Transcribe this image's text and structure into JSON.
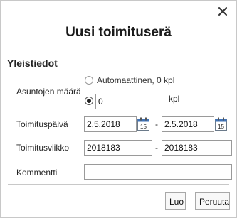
{
  "dialog": {
    "title": "Uusi toimituserä",
    "close_label": "×"
  },
  "section": {
    "heading": "Yleistiedot"
  },
  "quantity": {
    "label": "Asuntojen määrä",
    "auto_option": "Automaattinen, 0 kpl",
    "manual_value": "0",
    "unit": "kpl"
  },
  "delivery_date": {
    "label": "Toimituspäivä",
    "start": "2.5.2018",
    "separator": "-",
    "end": "2.5.2018",
    "calendar_day": "15"
  },
  "delivery_week": {
    "label": "Toimitusviikko",
    "start": "2018183",
    "separator": "-",
    "end": "2018183"
  },
  "comment": {
    "label": "Kommentti",
    "value": ""
  },
  "actions": {
    "create_label": "Luo",
    "cancel_label": "Peruuta"
  }
}
